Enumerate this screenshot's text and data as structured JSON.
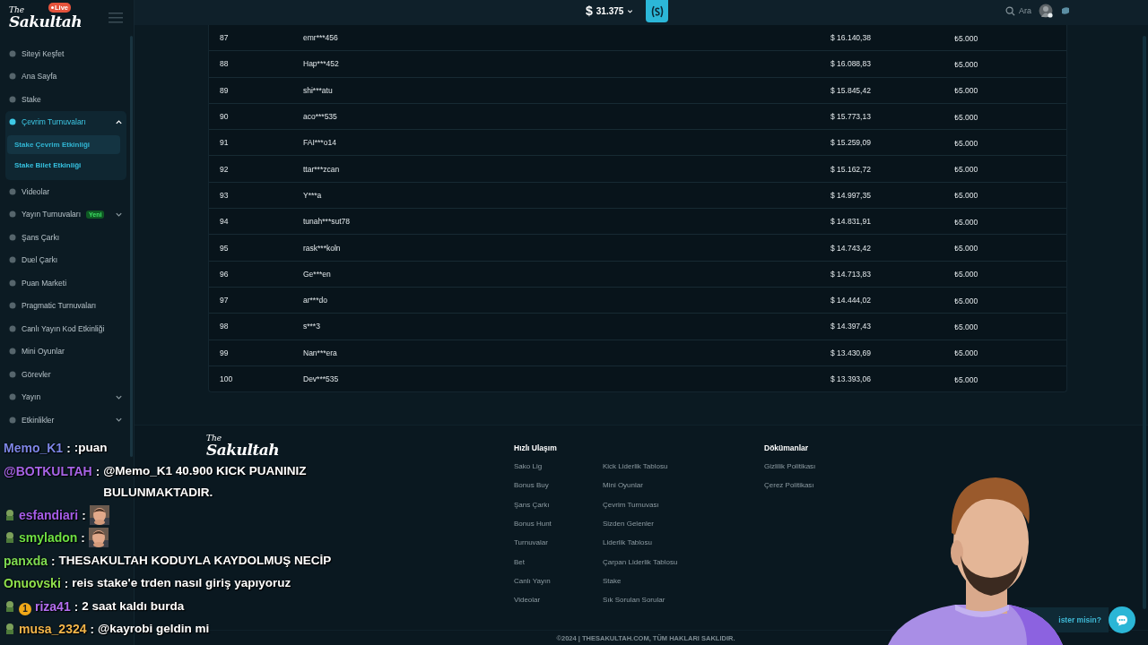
{
  "logo": {
    "small": "The",
    "name": "Sakultah",
    "badge": "Live"
  },
  "header": {
    "currency": "$",
    "balance": "31.375",
    "search_label": "Ara"
  },
  "sidebar": {
    "items": [
      {
        "kind": "link",
        "label": "Siteyi Keşfet"
      },
      {
        "kind": "link",
        "label": "Ana Sayfa"
      },
      {
        "kind": "link",
        "label": "Stake"
      },
      {
        "kind": "group",
        "label": "Çevrim Turnuvaları",
        "expanded": true,
        "children": [
          {
            "label": "Stake Çevrim Etkinliği",
            "selected": true
          },
          {
            "label": "Stake Bilet Etkinliği",
            "selected": false
          }
        ]
      },
      {
        "kind": "link",
        "label": "Videolar"
      },
      {
        "kind": "group",
        "label": "Yayın Turnuvaları",
        "badge": "Yeni",
        "expanded": false
      },
      {
        "kind": "link",
        "label": "Şans Çarkı"
      },
      {
        "kind": "link",
        "label": "Duel Çarkı"
      },
      {
        "kind": "link",
        "label": "Puan Marketi"
      },
      {
        "kind": "link",
        "label": "Pragmatic Turnuvaları"
      },
      {
        "kind": "link",
        "label": "Canlı Yayın Kod Etkinliği"
      },
      {
        "kind": "link",
        "label": "Mini Oyunlar"
      },
      {
        "kind": "link",
        "label": "Görevler"
      },
      {
        "kind": "group",
        "label": "Yayın",
        "expanded": false
      },
      {
        "kind": "group",
        "label": "Etkinlikler",
        "expanded": false
      }
    ]
  },
  "table": {
    "rows": [
      {
        "rank": "87",
        "user": "emr***456",
        "wagered": "$ 16.140,38",
        "prize": "₺5.000"
      },
      {
        "rank": "88",
        "user": "Hap***452",
        "wagered": "$ 16.088,83",
        "prize": "₺5.000"
      },
      {
        "rank": "89",
        "user": "shi***atu",
        "wagered": "$ 15.845,42",
        "prize": "₺5.000"
      },
      {
        "rank": "90",
        "user": "aco***535",
        "wagered": "$ 15.773,13",
        "prize": "₺5.000"
      },
      {
        "rank": "91",
        "user": "FAI***o14",
        "wagered": "$ 15.259,09",
        "prize": "₺5.000"
      },
      {
        "rank": "92",
        "user": "ttar***zcan",
        "wagered": "$ 15.162,72",
        "prize": "₺5.000"
      },
      {
        "rank": "93",
        "user": "Y***a",
        "wagered": "$ 14.997,35",
        "prize": "₺5.000"
      },
      {
        "rank": "94",
        "user": "tunah***sut78",
        "wagered": "$ 14.831,91",
        "prize": "₺5.000"
      },
      {
        "rank": "95",
        "user": "rask***koln",
        "wagered": "$ 14.743,42",
        "prize": "₺5.000"
      },
      {
        "rank": "96",
        "user": "Ge***en",
        "wagered": "$ 14.713,83",
        "prize": "₺5.000"
      },
      {
        "rank": "97",
        "user": "ar***do",
        "wagered": "$ 14.444,02",
        "prize": "₺5.000"
      },
      {
        "rank": "98",
        "user": "s***3",
        "wagered": "$ 14.397,43",
        "prize": "₺5.000"
      },
      {
        "rank": "99",
        "user": "Nan***era",
        "wagered": "$ 13.430,69",
        "prize": "₺5.000"
      },
      {
        "rank": "100",
        "user": "Dev***535",
        "wagered": "$ 13.393,06",
        "prize": "₺5.000"
      }
    ]
  },
  "footer": {
    "logo": {
      "small": "The",
      "name": "Sakultah"
    },
    "quick_links": {
      "title": "Hızlı Ulaşım",
      "columns": [
        [
          "Sako Lig",
          "Bonus Buy",
          "Şans Çarkı",
          "Bonus Hunt",
          "Turnuvalar",
          "Bet",
          "Canlı Yayın",
          "Videolar"
        ],
        [
          "Kick Liderlik Tablosu",
          "Mini Oyunlar",
          "Çevrim Turnuvası",
          "Sizden Gelenler",
          "Liderlik Tablosu",
          "Çarpan Liderlik Tablosu",
          "Stake",
          "Sık Sorulan Sorular"
        ]
      ]
    },
    "documents": {
      "title": "Dökümanlar",
      "links": [
        "Gizlilik Politikası",
        "Çerez Politikası"
      ]
    },
    "copyright": "©2024 | THESAKULTAH.COM, TÜM HAKLARI SAKLIDIR."
  },
  "chat": {
    "separator": ":",
    "lines": [
      {
        "user": "Memo_K1",
        "color": "#7d86e6",
        "badge": false,
        "kind": "text",
        "message": ":puan"
      },
      {
        "user": "@BOTKULTAH",
        "color": "#a764e6",
        "badge": false,
        "kind": "text",
        "message": "@Memo_K1 40.900 KICK PUANINIZ BULUNMAKTADIR."
      },
      {
        "user": "esfandiari",
        "color": "#a55de8",
        "badge": true,
        "kind": "emote"
      },
      {
        "user": "smyladon",
        "color": "#6ee044",
        "badge": true,
        "kind": "emote"
      },
      {
        "user": "panxda",
        "color": "#7fdc52",
        "badge": false,
        "kind": "text",
        "message": "THESAKULTAH KODUYLA KAYDOLMUŞ NECİP"
      },
      {
        "user": "Onuovski",
        "color": "#8fe04c",
        "badge": false,
        "kind": "text",
        "message": "reis stake'e trden nasıl giriş yapıyoruz"
      },
      {
        "user": "riza41",
        "color": "#b36ff0",
        "badge": true,
        "count": "1",
        "kind": "text",
        "message": "2 saat kaldı burda"
      },
      {
        "user": "musa_2324",
        "color": "#f2b54a",
        "badge": true,
        "kind": "text",
        "message": "@kayrobi geldin mi"
      }
    ]
  },
  "support": {
    "prompt": "ister misin?"
  }
}
